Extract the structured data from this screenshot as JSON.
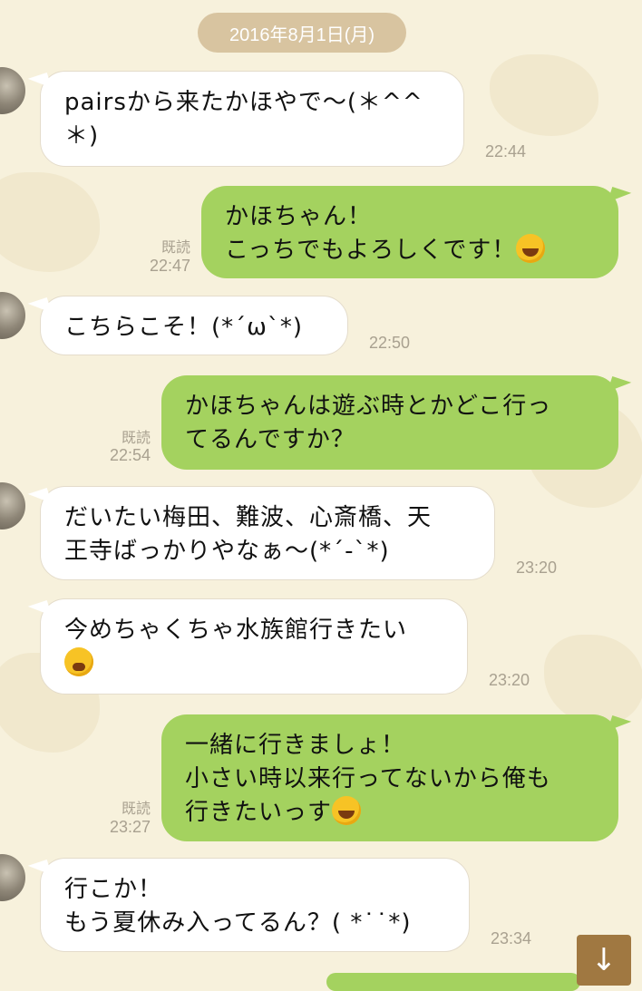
{
  "date_header": "2016年8月1日(月)",
  "messages": [
    {
      "text": "pairsから来たかほやで〜(＊^^\n＊)",
      "time": "22:44"
    },
    {
      "text": "かほちゃん！\nこっちでもよろしくです！",
      "read": "既読",
      "time": "22:47",
      "emoji": "grinning-squint"
    },
    {
      "text": "こちらこそ！(*´ω`*)",
      "time": "22:50"
    },
    {
      "text": "かほちゃんは遊ぶ時とかどこ行っ\nてるんですか？",
      "read": "既読",
      "time": "22:54"
    },
    {
      "text": "だいたい梅田、難波、心斎橋、天\n王寺ばっかりやなぁ〜(*´-`*)",
      "time": "23:20"
    },
    {
      "text": "今めちゃくちゃ水族館行きたい",
      "time": "23:20",
      "emoji": "weary"
    },
    {
      "text": "一緒に行きましょ！\n小さい時以来行ってないから俺も\n行きたいっす",
      "read": "既読",
      "time": "23:27",
      "emoji": "grinning-squint"
    },
    {
      "text": "行こか！\nもう夏休み入ってるん？( *˙˙*)",
      "time": "23:34"
    }
  ],
  "colors": {
    "sent_bubble": "#a4d25f",
    "received_bubble": "#ffffff",
    "background": "#f7f1dc",
    "date_pill": "#d8c4a0",
    "scroll_button": "#a07841"
  },
  "icons": {
    "scroll_down": "arrow-down-icon"
  }
}
